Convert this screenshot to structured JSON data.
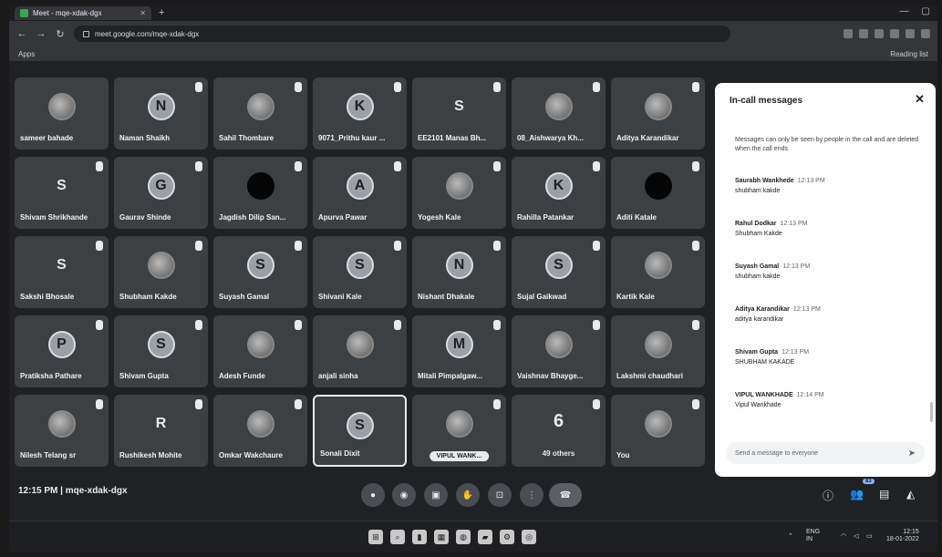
{
  "browser": {
    "tab_title": "Meet - mqe-xdak-dgx",
    "url": "meet.google.com/mqe-xdak-dgx",
    "apps_label": "Apps",
    "reading_list_label": "Reading list"
  },
  "tiles": [
    {
      "name": "sameer bahade",
      "initial": "",
      "avatar": "photo",
      "muted": false
    },
    {
      "name": "Naman Shaikh",
      "initial": "N",
      "avatar": "initial",
      "muted": true
    },
    {
      "name": "Sahil Thombare",
      "initial": "",
      "avatar": "photo",
      "muted": true
    },
    {
      "name": "9071_Prithu kaur ...",
      "initial": "K",
      "avatar": "initial",
      "muted": true
    },
    {
      "name": "EE2101 Manas Bh...",
      "initial": "S",
      "avatar": "letter",
      "muted": true
    },
    {
      "name": "08_Aishwarya Kh...",
      "initial": "",
      "avatar": "photo",
      "muted": true
    },
    {
      "name": "Aditya Karandikar",
      "initial": "",
      "avatar": "photo",
      "muted": true
    },
    {
      "name": "Shivam Shrikhande",
      "initial": "S",
      "avatar": "letter",
      "muted": true
    },
    {
      "name": "Gaurav Shinde",
      "initial": "G",
      "avatar": "initial",
      "muted": true
    },
    {
      "name": "Jagdish Dilip San...",
      "initial": "",
      "avatar": "dark",
      "muted": true
    },
    {
      "name": "Apurva Pawar",
      "initial": "A",
      "avatar": "initial",
      "muted": true
    },
    {
      "name": "Yogesh Kale",
      "initial": "",
      "avatar": "photo",
      "muted": true
    },
    {
      "name": "Rahilla Patankar",
      "initial": "K",
      "avatar": "initial",
      "muted": true
    },
    {
      "name": "Aditi Katale",
      "initial": "",
      "avatar": "dark",
      "muted": true
    },
    {
      "name": "Sakshi Bhosale",
      "initial": "S",
      "avatar": "letter",
      "muted": true
    },
    {
      "name": "Shubham Kakde",
      "initial": "",
      "avatar": "photo",
      "muted": true
    },
    {
      "name": "Suyash Gamal",
      "initial": "S",
      "avatar": "initial",
      "muted": true
    },
    {
      "name": "Shivani Kale",
      "initial": "S",
      "avatar": "initial",
      "muted": true
    },
    {
      "name": "Nishant Dhakale",
      "initial": "N",
      "avatar": "initial",
      "muted": true
    },
    {
      "name": "Sujal Gaikwad",
      "initial": "S",
      "avatar": "initial",
      "muted": true
    },
    {
      "name": "Kartik Kale",
      "initial": "",
      "avatar": "photo",
      "muted": true
    },
    {
      "name": "Pratiksha Pathare",
      "initial": "P",
      "avatar": "initial",
      "muted": true
    },
    {
      "name": "Shivam Gupta",
      "initial": "S",
      "avatar": "initial",
      "muted": true
    },
    {
      "name": "Adesh Funde",
      "initial": "",
      "avatar": "photo",
      "muted": true
    },
    {
      "name": "anjali sinha",
      "initial": "",
      "avatar": "photo",
      "muted": true
    },
    {
      "name": "Mitali Pimpalgaw...",
      "initial": "M",
      "avatar": "initial",
      "muted": true
    },
    {
      "name": "Vaishnav Bhayge...",
      "initial": "",
      "avatar": "photo",
      "muted": true
    },
    {
      "name": "Lakshmi chaudhari",
      "initial": "",
      "avatar": "photo",
      "muted": true
    },
    {
      "name": "Nilesh Telang sr",
      "initial": "",
      "avatar": "photo",
      "muted": true
    },
    {
      "name": "Rushikesh Mohite",
      "initial": "R",
      "avatar": "letter",
      "muted": true
    },
    {
      "name": "Omkar Wakchaure",
      "initial": "",
      "avatar": "photo",
      "muted": true
    },
    {
      "name": "Sonali Dixit",
      "initial": "S",
      "avatar": "initial",
      "muted": false
    },
    {
      "name": "",
      "initial": "",
      "avatar": "photo",
      "muted": true,
      "pin_label": "VIPUL WANK..."
    },
    {
      "name": "49 others",
      "initial": "6",
      "avatar": "others",
      "muted": true
    },
    {
      "name": "You",
      "initial": "",
      "avatar": "photo",
      "muted": true
    }
  ],
  "chat": {
    "title": "In-call messages",
    "close_label": "✕",
    "notice": "Messages can only be seen by people in the call and are deleted when the call ends",
    "messages": [
      {
        "sender": "Saurabh Wankhede",
        "time": "12:13 PM",
        "text": "shubham kakde"
      },
      {
        "sender": "Rahul Dodkar",
        "time": "12:13 PM",
        "text": "Shubham Kakde"
      },
      {
        "sender": "Suyash Gamal",
        "time": "12:13 PM",
        "text": "shubham kakde"
      },
      {
        "sender": "Aditya Karandikar",
        "time": "12:13 PM",
        "text": "aditya karandikar"
      },
      {
        "sender": "Shivam Gupta",
        "time": "12:13 PM",
        "text": "SHUBHAM KAKADE"
      },
      {
        "sender": "VIPUL WANKHADE",
        "time": "12:14 PM",
        "text": "Vipul Wankhade"
      }
    ],
    "input_placeholder": "Send a message to everyone",
    "send_icon": "➤"
  },
  "bottom": {
    "time": "12:15 PM",
    "separator": "|",
    "meeting_code": "mqe-xdak-dgx",
    "participant_badge": "83"
  },
  "taskbar": {
    "lang_top": "ENG",
    "lang_bottom": "IN",
    "clock_time": "12:15",
    "clock_date": "18-01-2022"
  }
}
